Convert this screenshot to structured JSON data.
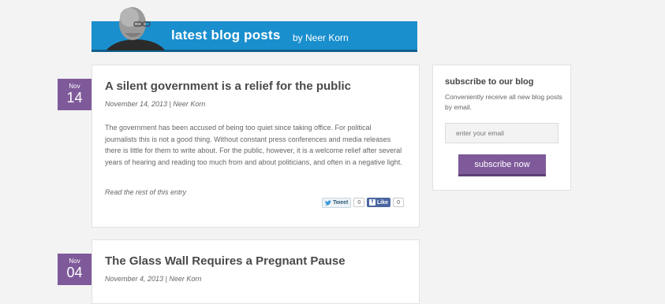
{
  "header": {
    "title": "latest blog posts",
    "author": "by Neer Korn"
  },
  "posts": [
    {
      "month": "Nov",
      "day": "14",
      "title": "A silent government is a relief for the public",
      "meta": "November 14, 2013 | Neer Korn",
      "excerpt": "The government has been accused of being too quiet since taking office. For political journalists this is not a good thing. Without constant press conferences and media releases there is little for them to write about. For the public, however, it is a welcome relief after several years of hearing and reading too much from and about politicians, and often in a negative light.",
      "read_more": "Read the rest of this entry",
      "tweet_label": "Tweet",
      "tweet_count": "0",
      "like_label": "Like",
      "like_count": "0"
    },
    {
      "month": "Nov",
      "day": "04",
      "title": "The Glass Wall Requires a Pregnant Pause",
      "meta": "November 4, 2013 | Neer Korn"
    }
  ],
  "subscribe": {
    "title": "subscribe to our blog",
    "text": "Conveniently receive all new blog posts by email.",
    "email_placeholder": "enter your email",
    "button_label": "subscribe now"
  },
  "colors": {
    "banner": "#1a8fce",
    "accent_purple": "#7f5a9b",
    "background": "#f3f3f3"
  }
}
